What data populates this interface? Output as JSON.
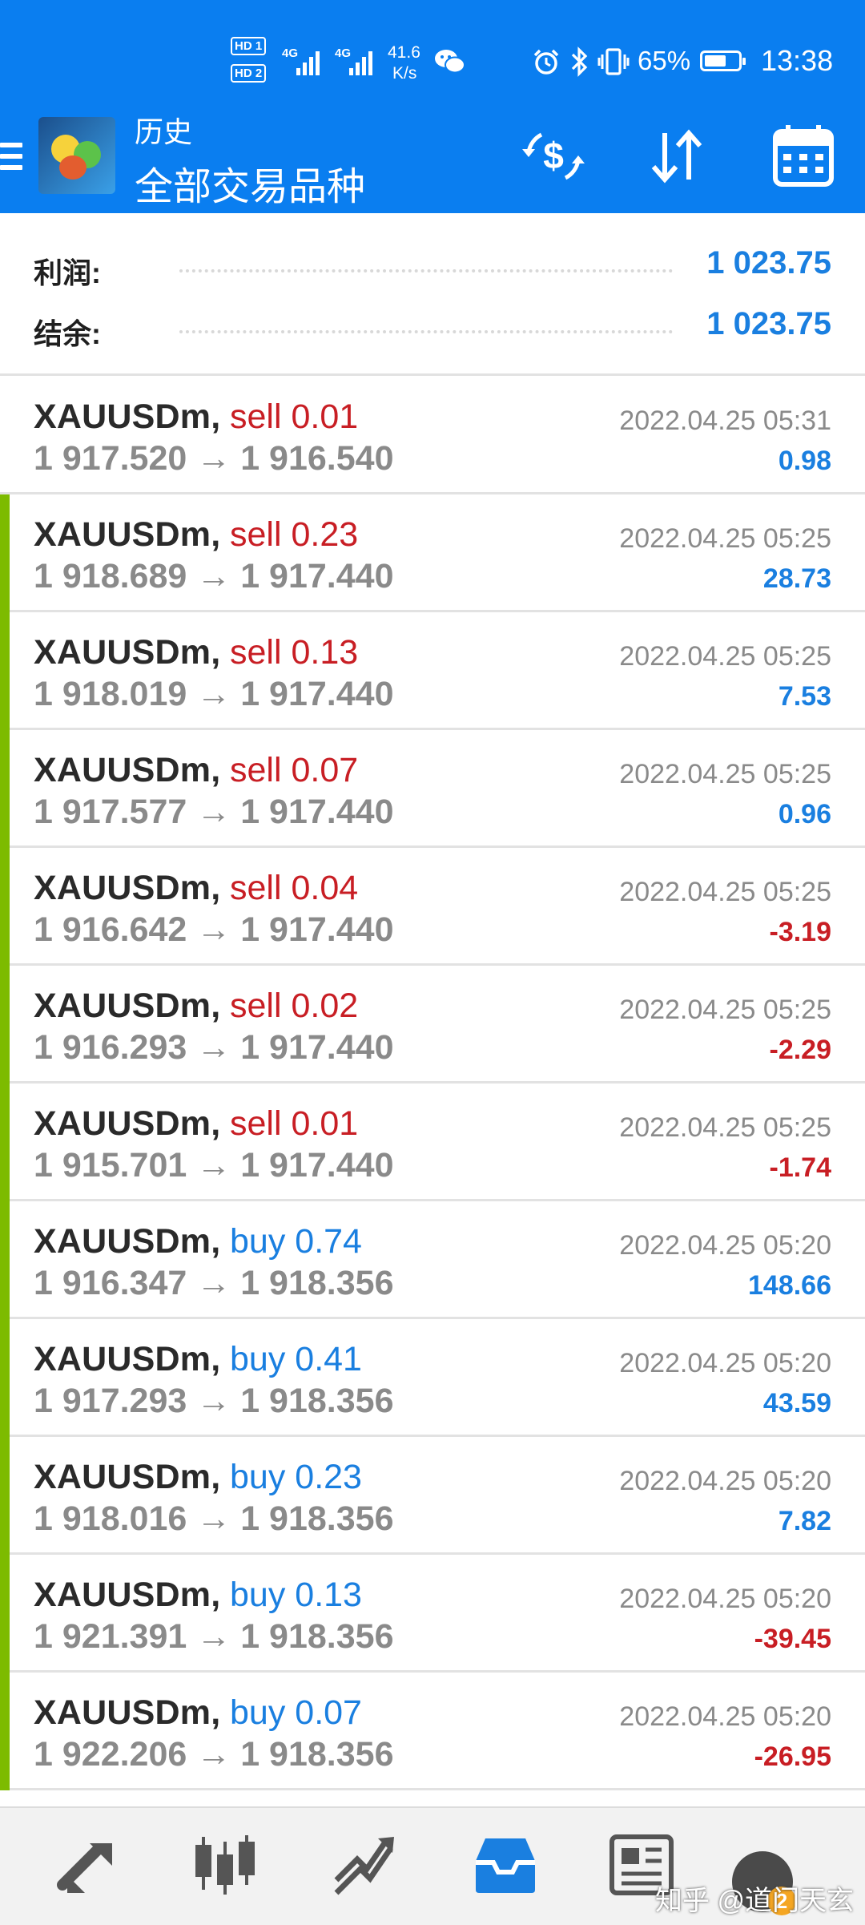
{
  "status_bar": {
    "hd1": "HD 1",
    "hd2": "HD 2",
    "net1": "4G",
    "net2": "4G",
    "speed_value": "41.6",
    "speed_unit": "K/s",
    "battery_percent": "65%",
    "battery_level": 0.65,
    "time": "13:38",
    "icons": [
      "wechat-icon",
      "alarm-icon",
      "bluetooth-icon",
      "vibrate-icon",
      "battery-icon"
    ]
  },
  "header": {
    "subtitle": "历史",
    "title": "全部交易品种",
    "icons": [
      "menu-icon",
      "app-logo",
      "currency-exchange-icon",
      "sort-icon",
      "calendar-icon"
    ]
  },
  "summary": [
    {
      "label": "利润:",
      "value": "1 023.75"
    },
    {
      "label": "结余:",
      "value": "1 023.75"
    }
  ],
  "trades": [
    {
      "symbol": "XAUUSDm,",
      "side": "sell 0.01",
      "side_type": "sell",
      "prices": "1 917.520 → 1 916.540",
      "time": "2022.04.25 05:31",
      "profit": "0.98",
      "profit_type": "pos",
      "marker": false
    },
    {
      "symbol": "XAUUSDm,",
      "side": "sell 0.23",
      "side_type": "sell",
      "prices": "1 918.689 → 1 917.440",
      "time": "2022.04.25 05:25",
      "profit": "28.73",
      "profit_type": "pos",
      "marker": true
    },
    {
      "symbol": "XAUUSDm,",
      "side": "sell 0.13",
      "side_type": "sell",
      "prices": "1 918.019 → 1 917.440",
      "time": "2022.04.25 05:25",
      "profit": "7.53",
      "profit_type": "pos",
      "marker": true
    },
    {
      "symbol": "XAUUSDm,",
      "side": "sell 0.07",
      "side_type": "sell",
      "prices": "1 917.577 → 1 917.440",
      "time": "2022.04.25 05:25",
      "profit": "0.96",
      "profit_type": "pos",
      "marker": true
    },
    {
      "symbol": "XAUUSDm,",
      "side": "sell 0.04",
      "side_type": "sell",
      "prices": "1 916.642 → 1 917.440",
      "time": "2022.04.25 05:25",
      "profit": "-3.19",
      "profit_type": "neg",
      "marker": true
    },
    {
      "symbol": "XAUUSDm,",
      "side": "sell 0.02",
      "side_type": "sell",
      "prices": "1 916.293 → 1 917.440",
      "time": "2022.04.25 05:25",
      "profit": "-2.29",
      "profit_type": "neg",
      "marker": true
    },
    {
      "symbol": "XAUUSDm,",
      "side": "sell 0.01",
      "side_type": "sell",
      "prices": "1 915.701 → 1 917.440",
      "time": "2022.04.25 05:25",
      "profit": "-1.74",
      "profit_type": "neg",
      "marker": true
    },
    {
      "symbol": "XAUUSDm,",
      "side": "buy 0.74",
      "side_type": "buy",
      "prices": "1 916.347 → 1 918.356",
      "time": "2022.04.25 05:20",
      "profit": "148.66",
      "profit_type": "pos",
      "marker": true
    },
    {
      "symbol": "XAUUSDm,",
      "side": "buy 0.41",
      "side_type": "buy",
      "prices": "1 917.293 → 1 918.356",
      "time": "2022.04.25 05:20",
      "profit": "43.59",
      "profit_type": "pos",
      "marker": true
    },
    {
      "symbol": "XAUUSDm,",
      "side": "buy 0.23",
      "side_type": "buy",
      "prices": "1 918.016 → 1 918.356",
      "time": "2022.04.25 05:20",
      "profit": "7.82",
      "profit_type": "pos",
      "marker": true
    },
    {
      "symbol": "XAUUSDm,",
      "side": "buy 0.13",
      "side_type": "buy",
      "prices": "1 921.391 → 1 918.356",
      "time": "2022.04.25 05:20",
      "profit": "-39.45",
      "profit_type": "neg",
      "marker": true
    },
    {
      "symbol": "XAUUSDm,",
      "side": "buy 0.07",
      "side_type": "buy",
      "prices": "1 922.206 → 1 918.356",
      "time": "2022.04.25 05:20",
      "profit": "-26.95",
      "profit_type": "neg",
      "marker": true
    }
  ],
  "bottom_nav": {
    "items": [
      "quotes-icon",
      "chart-icon",
      "trade-icon",
      "history-icon",
      "news-icon",
      "messages-icon"
    ],
    "active": "history-icon"
  },
  "watermark": {
    "text": "知乎 @道门天玄",
    "badge": "2"
  },
  "colors": {
    "header_bg": "#0a7ef0",
    "positive": "#1a7fe0",
    "negative": "#c81e24",
    "marker": "#7dbb00",
    "muted": "#8a8a8a"
  }
}
